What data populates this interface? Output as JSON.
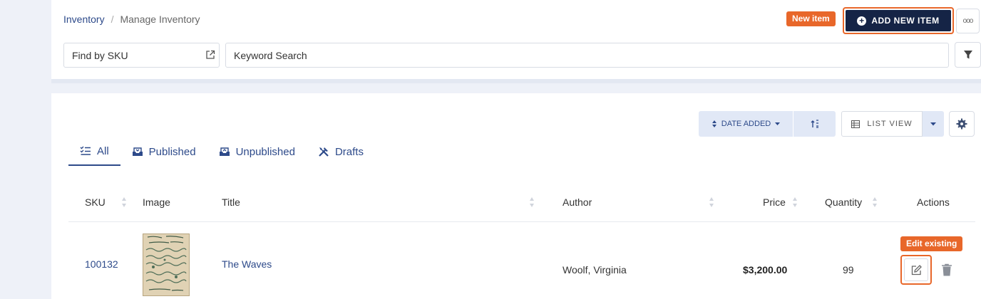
{
  "breadcrumb": {
    "root": "Inventory",
    "separator": "/",
    "current": "Manage Inventory"
  },
  "callouts": {
    "new_item": "New item",
    "edit_existing": "Edit existing"
  },
  "header": {
    "add_button_label": "ADD NEW ITEM",
    "more_label": "ooo"
  },
  "search": {
    "sku_value": "Find by SKU",
    "keyword_value": "Keyword Search"
  },
  "toolbar": {
    "sort_label": "DATE ADDED",
    "view_label": "LIST VIEW"
  },
  "tabs": [
    {
      "label": "All",
      "icon": "checklist-icon",
      "active": true
    },
    {
      "label": "Published",
      "icon": "inbox-in-icon",
      "active": false
    },
    {
      "label": "Unpublished",
      "icon": "inbox-out-icon",
      "active": false
    },
    {
      "label": "Drafts",
      "icon": "tools-icon",
      "active": false
    }
  ],
  "table": {
    "columns": {
      "sku": "SKU",
      "image": "Image",
      "title": "Title",
      "author": "Author",
      "price": "Price",
      "quantity": "Quantity",
      "actions": "Actions"
    },
    "rows": [
      {
        "sku": "100132",
        "title": "The Waves",
        "author": "Woolf, Virginia",
        "price": "$3,200.00",
        "quantity": "99"
      }
    ]
  },
  "colors": {
    "accent": "#e8672a",
    "navy": "#152446",
    "link": "#2d4a8a",
    "soft_blue": "#e1e8f6"
  }
}
